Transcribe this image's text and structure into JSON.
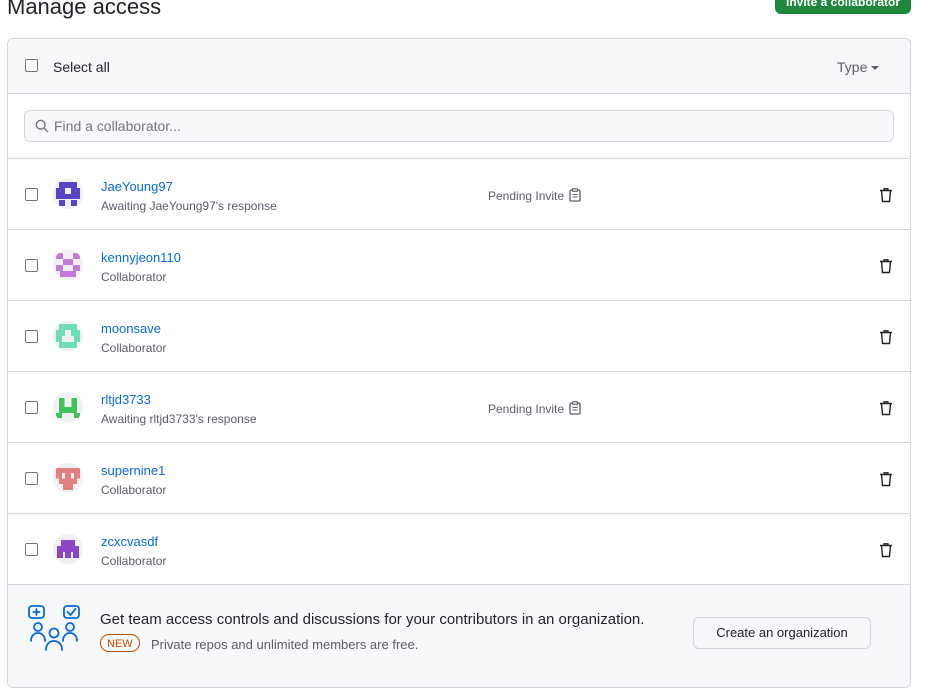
{
  "page": {
    "title": "Manage access"
  },
  "toolbar": {
    "invite_label": "Invite a collaborator"
  },
  "header": {
    "select_all_label": "Select all",
    "type_label": "Type"
  },
  "search": {
    "placeholder": "Find a collaborator..."
  },
  "collaborators": [
    {
      "username": "JaeYoung97",
      "subtitle": "Awaiting JaeYoung97's response",
      "status": "Pending Invite",
      "avatar_color": "#5a44c4"
    },
    {
      "username": "kennyjeon110",
      "subtitle": "Collaborator",
      "status": "",
      "avatar_color": "#c77bd9"
    },
    {
      "username": "moonsave",
      "subtitle": "Collaborator",
      "status": "",
      "avatar_color": "#6fe0b6"
    },
    {
      "username": "rltjd3733",
      "subtitle": "Awaiting rltjd3733's response",
      "status": "Pending Invite",
      "avatar_color": "#3fc25a"
    },
    {
      "username": "supernine1",
      "subtitle": "Collaborator",
      "status": "",
      "avatar_color": "#e0807f"
    },
    {
      "username": "zcxcvasdf",
      "subtitle": "Collaborator",
      "status": "",
      "avatar_color": "#8a46c9"
    }
  ],
  "footer": {
    "promo_text": "Get team access controls and discussions for your contributors in an organization.",
    "badge": "NEW",
    "sub_text": "Private repos and unlimited members are free.",
    "create_org_label": "Create an organization"
  },
  "colors": {
    "link": "#0969da",
    "primary_button": "#1f883d",
    "new_badge": "#bc4c00"
  }
}
